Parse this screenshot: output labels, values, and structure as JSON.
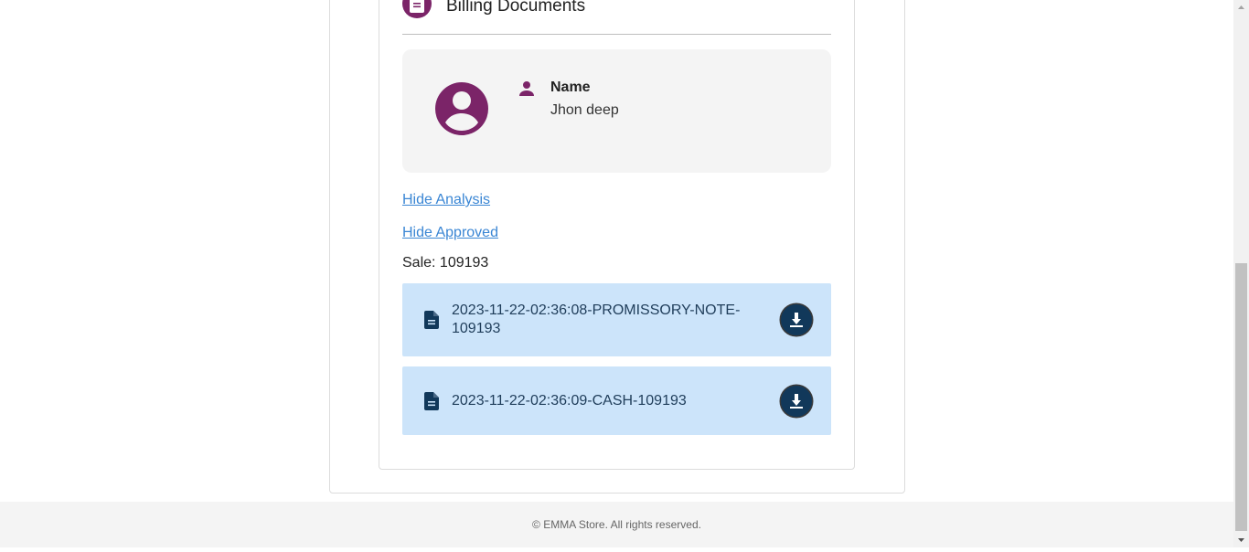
{
  "section": {
    "title": "Billing Documents",
    "icon": "document-icon"
  },
  "profile": {
    "avatar_icon": "account-circle-icon",
    "person_icon": "person-icon",
    "name_label": "Name",
    "name_value": "Jhon deep"
  },
  "links": {
    "hide_analysis": "Hide Analysis",
    "hide_approved": "Hide Approved"
  },
  "sale": {
    "text": "Sale: 109193"
  },
  "documents": [
    {
      "name": "2023-11-22-02:36:08-PROMISSORY-NOTE-109193",
      "icon": "file-icon",
      "action_icon": "download-icon"
    },
    {
      "name": "2023-11-22-02:36:09-CASH-109193",
      "icon": "file-icon",
      "action_icon": "download-icon"
    }
  ],
  "footer": {
    "text": "© EMMA Store. All rights reserved."
  },
  "colors": {
    "brand_purple": "#7b2468",
    "link_blue": "#3a86d4",
    "doc_bg": "#cce4fa",
    "doc_text": "#1f3d5a",
    "download_btn": "#11385a"
  }
}
